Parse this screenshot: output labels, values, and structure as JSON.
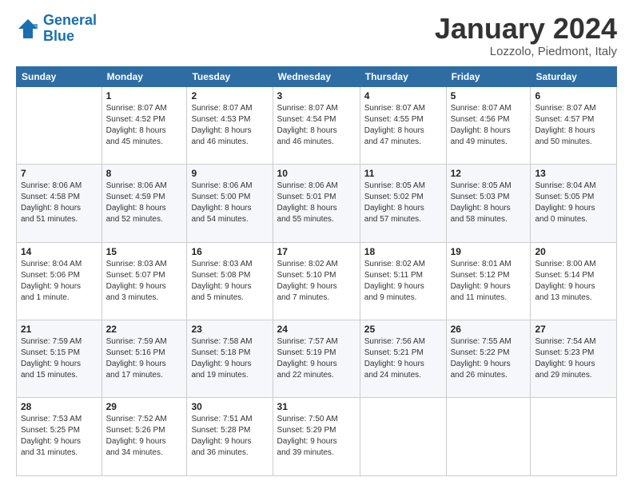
{
  "logo": {
    "line1": "General",
    "line2": "Blue"
  },
  "header": {
    "month": "January 2024",
    "location": "Lozzolo, Piedmont, Italy"
  },
  "weekdays": [
    "Sunday",
    "Monday",
    "Tuesday",
    "Wednesday",
    "Thursday",
    "Friday",
    "Saturday"
  ],
  "weeks": [
    [
      {
        "day": "",
        "info": ""
      },
      {
        "day": "1",
        "info": "Sunrise: 8:07 AM\nSunset: 4:52 PM\nDaylight: 8 hours\nand 45 minutes."
      },
      {
        "day": "2",
        "info": "Sunrise: 8:07 AM\nSunset: 4:53 PM\nDaylight: 8 hours\nand 46 minutes."
      },
      {
        "day": "3",
        "info": "Sunrise: 8:07 AM\nSunset: 4:54 PM\nDaylight: 8 hours\nand 46 minutes."
      },
      {
        "day": "4",
        "info": "Sunrise: 8:07 AM\nSunset: 4:55 PM\nDaylight: 8 hours\nand 47 minutes."
      },
      {
        "day": "5",
        "info": "Sunrise: 8:07 AM\nSunset: 4:56 PM\nDaylight: 8 hours\nand 49 minutes."
      },
      {
        "day": "6",
        "info": "Sunrise: 8:07 AM\nSunset: 4:57 PM\nDaylight: 8 hours\nand 50 minutes."
      }
    ],
    [
      {
        "day": "7",
        "info": "Sunrise: 8:06 AM\nSunset: 4:58 PM\nDaylight: 8 hours\nand 51 minutes."
      },
      {
        "day": "8",
        "info": "Sunrise: 8:06 AM\nSunset: 4:59 PM\nDaylight: 8 hours\nand 52 minutes."
      },
      {
        "day": "9",
        "info": "Sunrise: 8:06 AM\nSunset: 5:00 PM\nDaylight: 8 hours\nand 54 minutes."
      },
      {
        "day": "10",
        "info": "Sunrise: 8:06 AM\nSunset: 5:01 PM\nDaylight: 8 hours\nand 55 minutes."
      },
      {
        "day": "11",
        "info": "Sunrise: 8:05 AM\nSunset: 5:02 PM\nDaylight: 8 hours\nand 57 minutes."
      },
      {
        "day": "12",
        "info": "Sunrise: 8:05 AM\nSunset: 5:03 PM\nDaylight: 8 hours\nand 58 minutes."
      },
      {
        "day": "13",
        "info": "Sunrise: 8:04 AM\nSunset: 5:05 PM\nDaylight: 9 hours\nand 0 minutes."
      }
    ],
    [
      {
        "day": "14",
        "info": "Sunrise: 8:04 AM\nSunset: 5:06 PM\nDaylight: 9 hours\nand 1 minute."
      },
      {
        "day": "15",
        "info": "Sunrise: 8:03 AM\nSunset: 5:07 PM\nDaylight: 9 hours\nand 3 minutes."
      },
      {
        "day": "16",
        "info": "Sunrise: 8:03 AM\nSunset: 5:08 PM\nDaylight: 9 hours\nand 5 minutes."
      },
      {
        "day": "17",
        "info": "Sunrise: 8:02 AM\nSunset: 5:10 PM\nDaylight: 9 hours\nand 7 minutes."
      },
      {
        "day": "18",
        "info": "Sunrise: 8:02 AM\nSunset: 5:11 PM\nDaylight: 9 hours\nand 9 minutes."
      },
      {
        "day": "19",
        "info": "Sunrise: 8:01 AM\nSunset: 5:12 PM\nDaylight: 9 hours\nand 11 minutes."
      },
      {
        "day": "20",
        "info": "Sunrise: 8:00 AM\nSunset: 5:14 PM\nDaylight: 9 hours\nand 13 minutes."
      }
    ],
    [
      {
        "day": "21",
        "info": "Sunrise: 7:59 AM\nSunset: 5:15 PM\nDaylight: 9 hours\nand 15 minutes."
      },
      {
        "day": "22",
        "info": "Sunrise: 7:59 AM\nSunset: 5:16 PM\nDaylight: 9 hours\nand 17 minutes."
      },
      {
        "day": "23",
        "info": "Sunrise: 7:58 AM\nSunset: 5:18 PM\nDaylight: 9 hours\nand 19 minutes."
      },
      {
        "day": "24",
        "info": "Sunrise: 7:57 AM\nSunset: 5:19 PM\nDaylight: 9 hours\nand 22 minutes."
      },
      {
        "day": "25",
        "info": "Sunrise: 7:56 AM\nSunset: 5:21 PM\nDaylight: 9 hours\nand 24 minutes."
      },
      {
        "day": "26",
        "info": "Sunrise: 7:55 AM\nSunset: 5:22 PM\nDaylight: 9 hours\nand 26 minutes."
      },
      {
        "day": "27",
        "info": "Sunrise: 7:54 AM\nSunset: 5:23 PM\nDaylight: 9 hours\nand 29 minutes."
      }
    ],
    [
      {
        "day": "28",
        "info": "Sunrise: 7:53 AM\nSunset: 5:25 PM\nDaylight: 9 hours\nand 31 minutes."
      },
      {
        "day": "29",
        "info": "Sunrise: 7:52 AM\nSunset: 5:26 PM\nDaylight: 9 hours\nand 34 minutes."
      },
      {
        "day": "30",
        "info": "Sunrise: 7:51 AM\nSunset: 5:28 PM\nDaylight: 9 hours\nand 36 minutes."
      },
      {
        "day": "31",
        "info": "Sunrise: 7:50 AM\nSunset: 5:29 PM\nDaylight: 9 hours\nand 39 minutes."
      },
      {
        "day": "",
        "info": ""
      },
      {
        "day": "",
        "info": ""
      },
      {
        "day": "",
        "info": ""
      }
    ]
  ]
}
